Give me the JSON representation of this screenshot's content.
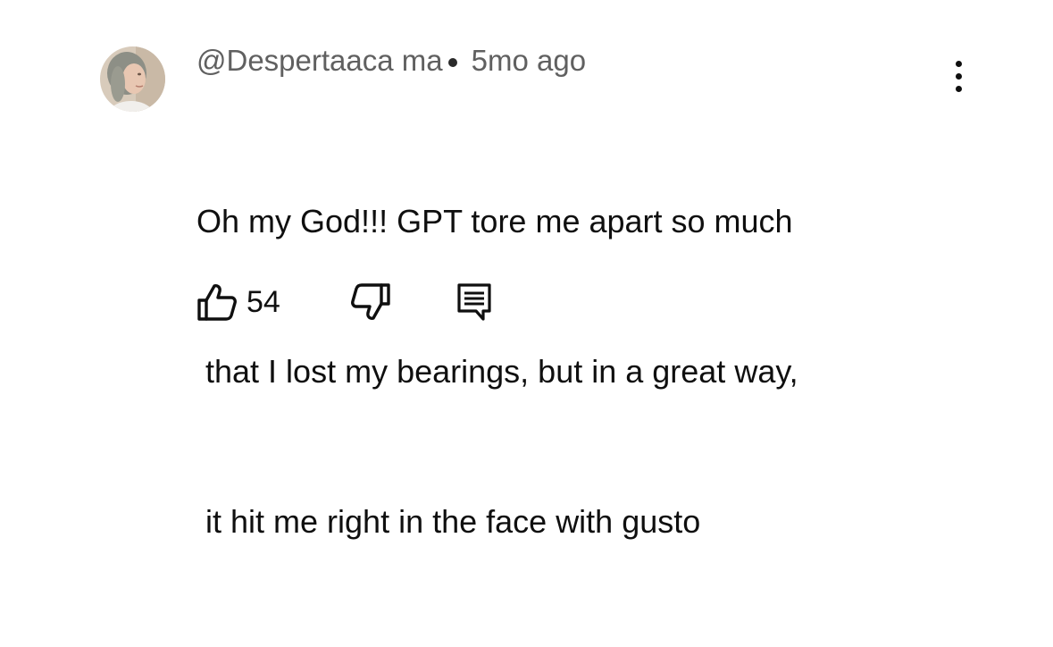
{
  "comment": {
    "author": "@Despertaaca ma",
    "time": "5mo ago",
    "text_lines": [
      "Oh my God!!! GPT tore me apart so much",
      " that I lost my bearings, but in a great way,",
      " it hit me right in the face with gusto"
    ],
    "like_count": "54",
    "avatar_icon": "user-avatar-photo",
    "icons": {
      "like": "thumbs-up-icon",
      "dislike": "thumbs-down-icon",
      "reply": "reply-comment-icon",
      "menu": "more-vertical-icon"
    },
    "colors": {
      "text": "#0f0f0f",
      "meta": "#606060"
    }
  }
}
